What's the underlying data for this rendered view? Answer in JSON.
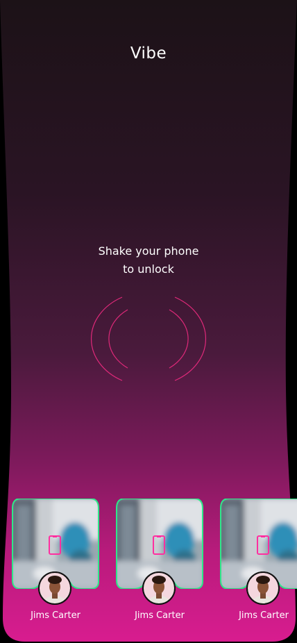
{
  "app": {
    "title": "Vibe"
  },
  "unlock": {
    "line1": "Shake your phone",
    "line2": "to unlock"
  },
  "cards": [
    {
      "name": "Jims Carter"
    },
    {
      "name": "Jims Carter"
    },
    {
      "name": "Jims Carter"
    }
  ],
  "colors": {
    "background_top": "#1c1217",
    "background_bottom": "#d81c8f",
    "card_border": "#2ee88a",
    "ring": "#e0297a",
    "phone_icon": "#ff2fa0"
  },
  "icons": {
    "phone": "phone-outline-icon",
    "shake": "shake-rings-icon"
  }
}
